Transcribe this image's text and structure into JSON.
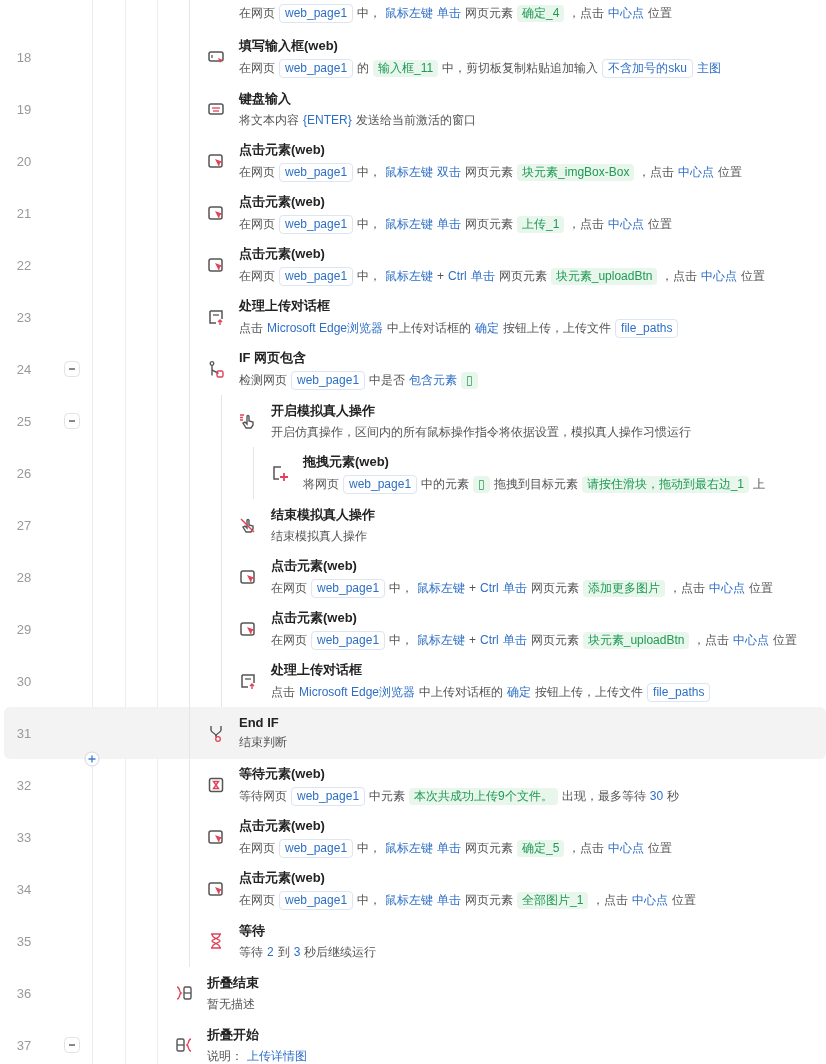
{
  "steps": [
    {
      "selected": false,
      "desc": [
        {
          "kind": "text",
          "text": "在网页"
        },
        {
          "kind": "var",
          "text": "web_page1"
        },
        {
          "kind": "text",
          "text": "中，"
        },
        {
          "kind": "kw",
          "text": "鼠标左键"
        },
        {
          "kind": "kw",
          "text": "单击"
        },
        {
          "kind": "text",
          "text": "网页元素"
        },
        {
          "kind": "elem",
          "text": "确定_4"
        },
        {
          "kind": "text",
          "text": "，点击"
        },
        {
          "kind": "kw",
          "text": "中心点"
        },
        {
          "kind": "text",
          "text": "位置"
        }
      ]
    },
    {
      "num": "18",
      "kind": "fill",
      "title": "填写输入框(web)",
      "selected": false,
      "desc": [
        {
          "kind": "text",
          "text": "在网页"
        },
        {
          "kind": "var",
          "text": "web_page1"
        },
        {
          "kind": "text",
          "text": "的"
        },
        {
          "kind": "elem",
          "text": "输入框_11"
        },
        {
          "kind": "text",
          "text": "中，剪切板复制粘贴追加输入"
        },
        {
          "kind": "var",
          "text": "不含加号的sku"
        },
        {
          "kind": "kw",
          "text": "主图"
        }
      ]
    },
    {
      "num": "19",
      "kind": "keyboard",
      "title": "键盘输入",
      "selected": false,
      "desc": [
        {
          "kind": "text",
          "text": "将文本内容"
        },
        {
          "kind": "kw",
          "text": "{ENTER}"
        },
        {
          "kind": "text",
          "text": "发送给当前激活的窗口"
        }
      ]
    },
    {
      "num": "20",
      "kind": "click",
      "title": "点击元素(web)",
      "selected": false,
      "desc": [
        {
          "kind": "text",
          "text": "在网页"
        },
        {
          "kind": "var",
          "text": "web_page1"
        },
        {
          "kind": "text",
          "text": "中，"
        },
        {
          "kind": "kw",
          "text": "鼠标左键"
        },
        {
          "kind": "kw",
          "text": "双击"
        },
        {
          "kind": "text",
          "text": "网页元素"
        },
        {
          "kind": "elem",
          "text": "块元素_imgBox-Box"
        },
        {
          "kind": "text",
          "text": "，点击"
        },
        {
          "kind": "kw",
          "text": "中心点"
        },
        {
          "kind": "text",
          "text": "位置"
        }
      ]
    },
    {
      "num": "21",
      "kind": "click",
      "title": "点击元素(web)",
      "selected": false,
      "desc": [
        {
          "kind": "text",
          "text": "在网页"
        },
        {
          "kind": "var",
          "text": "web_page1"
        },
        {
          "kind": "text",
          "text": "中，"
        },
        {
          "kind": "kw",
          "text": "鼠标左键"
        },
        {
          "kind": "kw",
          "text": "单击"
        },
        {
          "kind": "text",
          "text": "网页元素"
        },
        {
          "kind": "elem",
          "text": "上传_1"
        },
        {
          "kind": "text",
          "text": "，点击"
        },
        {
          "kind": "kw",
          "text": "中心点"
        },
        {
          "kind": "text",
          "text": "位置"
        }
      ]
    },
    {
      "num": "22",
      "kind": "click",
      "title": "点击元素(web)",
      "selected": false,
      "desc": [
        {
          "kind": "text",
          "text": "在网页"
        },
        {
          "kind": "var",
          "text": "web_page1"
        },
        {
          "kind": "text",
          "text": "中，"
        },
        {
          "kind": "kw",
          "text": "鼠标左键"
        },
        {
          "kind": "text",
          "text": "+"
        },
        {
          "kind": "kw",
          "text": "Ctrl"
        },
        {
          "kind": "kw",
          "text": "单击"
        },
        {
          "kind": "text",
          "text": "网页元素"
        },
        {
          "kind": "elem",
          "text": "块元素_uploadBtn"
        },
        {
          "kind": "text",
          "text": "，点击"
        },
        {
          "kind": "kw",
          "text": "中心点"
        },
        {
          "kind": "text",
          "text": "位置"
        }
      ]
    },
    {
      "num": "23",
      "kind": "upload",
      "title": "处理上传对话框",
      "selected": false,
      "desc": [
        {
          "kind": "text",
          "text": "点击"
        },
        {
          "kind": "kw",
          "text": "Microsoft Edge浏览器"
        },
        {
          "kind": "text",
          "text": "中上传对话框的"
        },
        {
          "kind": "kw",
          "text": "确定"
        },
        {
          "kind": "text",
          "text": "按钮上传，上传文件"
        },
        {
          "kind": "var",
          "text": "file_paths"
        }
      ]
    },
    {
      "num": "24",
      "kind": "if",
      "title": "IF 网页包含",
      "selected": false,
      "expanded": true,
      "desc": [
        {
          "kind": "text",
          "text": "检测网页"
        },
        {
          "kind": "var",
          "text": "web_page1"
        },
        {
          "kind": "text",
          "text": "中是否"
        },
        {
          "kind": "kw",
          "text": "包含元素"
        },
        {
          "kind": "elem",
          "text": "▯"
        }
      ],
      "children": [
        {
          "num": "25",
          "kind": "sim_start",
          "title": "开启模拟真人操作",
          "selected": false,
          "expanded": true,
          "desc": [
            {
              "kind": "text",
              "text": "开启仿真操作，区间内的所有鼠标操作指令将依据设置，模拟真人操作习惯运行"
            }
          ],
          "children": [
            {
              "num": "26",
              "kind": "drag",
              "title": "拖拽元素(web)",
              "selected": false,
              "desc": [
                {
                  "kind": "text",
                  "text": "将网页"
                },
                {
                  "kind": "var",
                  "text": "web_page1"
                },
                {
                  "kind": "text",
                  "text": "中的元素"
                },
                {
                  "kind": "elem",
                  "text": "▯"
                },
                {
                  "kind": "text",
                  "text": "拖拽到目标元素"
                },
                {
                  "kind": "elem",
                  "text": "请按住滑块，拖动到最右边_1"
                },
                {
                  "kind": "text",
                  "text": "上"
                }
              ]
            }
          ]
        },
        {
          "num": "27",
          "kind": "sim_end",
          "title": "结束模拟真人操作",
          "selected": false,
          "desc": [
            {
              "kind": "text",
              "text": "结束模拟真人操作"
            }
          ]
        },
        {
          "num": "28",
          "kind": "click",
          "title": "点击元素(web)",
          "selected": false,
          "desc": [
            {
              "kind": "text",
              "text": "在网页"
            },
            {
              "kind": "var",
              "text": "web_page1"
            },
            {
              "kind": "text",
              "text": "中，"
            },
            {
              "kind": "kw",
              "text": "鼠标左键"
            },
            {
              "kind": "text",
              "text": "+"
            },
            {
              "kind": "kw",
              "text": "Ctrl"
            },
            {
              "kind": "kw",
              "text": "单击"
            },
            {
              "kind": "text",
              "text": "网页元素"
            },
            {
              "kind": "elem",
              "text": "添加更多图片"
            },
            {
              "kind": "text",
              "text": "，点击"
            },
            {
              "kind": "kw",
              "text": "中心点"
            },
            {
              "kind": "text",
              "text": "位置"
            }
          ]
        },
        {
          "num": "29",
          "kind": "click",
          "title": "点击元素(web)",
          "selected": false,
          "desc": [
            {
              "kind": "text",
              "text": "在网页"
            },
            {
              "kind": "var",
              "text": "web_page1"
            },
            {
              "kind": "text",
              "text": "中，"
            },
            {
              "kind": "kw",
              "text": "鼠标左键"
            },
            {
              "kind": "text",
              "text": "+"
            },
            {
              "kind": "kw",
              "text": "Ctrl"
            },
            {
              "kind": "kw",
              "text": "单击"
            },
            {
              "kind": "text",
              "text": "网页元素"
            },
            {
              "kind": "elem",
              "text": "块元素_uploadBtn"
            },
            {
              "kind": "text",
              "text": "，点击"
            },
            {
              "kind": "kw",
              "text": "中心点"
            },
            {
              "kind": "text",
              "text": "位置"
            }
          ]
        },
        {
          "num": "30",
          "kind": "upload",
          "title": "处理上传对话框",
          "selected": false,
          "desc": [
            {
              "kind": "text",
              "text": "点击"
            },
            {
              "kind": "kw",
              "text": "Microsoft Edge浏览器"
            },
            {
              "kind": "text",
              "text": "中上传对话框的"
            },
            {
              "kind": "kw",
              "text": "确定"
            },
            {
              "kind": "text",
              "text": "按钮上传，上传文件"
            },
            {
              "kind": "var",
              "text": "file_paths"
            }
          ]
        }
      ]
    },
    {
      "num": "31",
      "kind": "endif",
      "title": "End IF",
      "selected": true,
      "add_button_below": true,
      "desc": [
        {
          "kind": "text",
          "text": "结束判断"
        }
      ]
    },
    {
      "num": "32",
      "kind": "wait_element",
      "title": "等待元素(web)",
      "selected": false,
      "desc": [
        {
          "kind": "text",
          "text": "等待网页"
        },
        {
          "kind": "var",
          "text": "web_page1"
        },
        {
          "kind": "text",
          "text": "中元素"
        },
        {
          "kind": "elem",
          "text": "本次共成功上传9个文件。"
        },
        {
          "kind": "text",
          "text": "出现，最多等待"
        },
        {
          "kind": "kw",
          "text": "30"
        },
        {
          "kind": "text",
          "text": "秒"
        }
      ]
    },
    {
      "num": "33",
      "kind": "click",
      "title": "点击元素(web)",
      "selected": false,
      "desc": [
        {
          "kind": "text",
          "text": "在网页"
        },
        {
          "kind": "var",
          "text": "web_page1"
        },
        {
          "kind": "text",
          "text": "中，"
        },
        {
          "kind": "kw",
          "text": "鼠标左键"
        },
        {
          "kind": "kw",
          "text": "单击"
        },
        {
          "kind": "text",
          "text": "网页元素"
        },
        {
          "kind": "elem",
          "text": "确定_5"
        },
        {
          "kind": "text",
          "text": "，点击"
        },
        {
          "kind": "kw",
          "text": "中心点"
        },
        {
          "kind": "text",
          "text": "位置"
        }
      ]
    },
    {
      "num": "34",
      "kind": "click",
      "title": "点击元素(web)",
      "selected": false,
      "desc": [
        {
          "kind": "text",
          "text": "在网页"
        },
        {
          "kind": "var",
          "text": "web_page1"
        },
        {
          "kind": "text",
          "text": "中，"
        },
        {
          "kind": "kw",
          "text": "鼠标左键"
        },
        {
          "kind": "kw",
          "text": "单击"
        },
        {
          "kind": "text",
          "text": "网页元素"
        },
        {
          "kind": "elem",
          "text": "全部图片_1"
        },
        {
          "kind": "text",
          "text": "，点击"
        },
        {
          "kind": "kw",
          "text": "中心点"
        },
        {
          "kind": "text",
          "text": "位置"
        }
      ]
    },
    {
      "num": "35",
      "kind": "wait",
      "title": "等待",
      "selected": false,
      "desc": [
        {
          "kind": "text",
          "text": "等待"
        },
        {
          "kind": "kw",
          "text": "2"
        },
        {
          "kind": "text",
          "text": "到"
        },
        {
          "kind": "kw",
          "text": "3"
        },
        {
          "kind": "text",
          "text": "秒后继续运行"
        }
      ]
    }
  ],
  "outer_steps": [
    {
      "num": "36",
      "kind": "fold_end",
      "title": "折叠结束",
      "selected": false,
      "desc": [
        {
          "kind": "text",
          "text": "暂无描述"
        }
      ]
    },
    {
      "num": "37",
      "kind": "fold_start",
      "title": "折叠开始",
      "selected": false,
      "expanded": true,
      "desc": [
        {
          "kind": "text",
          "text": "说明："
        },
        {
          "kind": "kw",
          "text": "上传详情图"
        }
      ]
    }
  ]
}
